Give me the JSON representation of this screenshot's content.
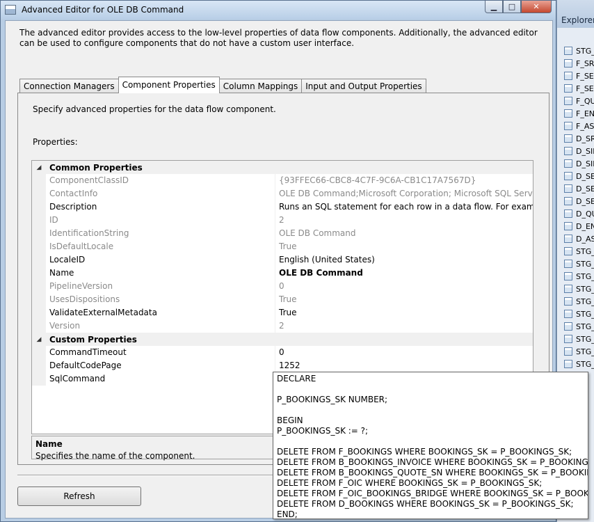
{
  "window": {
    "title": "Advanced Editor for OLE DB Command"
  },
  "intro_text": "The advanced editor provides access to the low-level properties of data flow components. Additionally, the advanced editor can be used to configure components that do not have a custom user interface.",
  "tabs": [
    {
      "label": "Connection Managers"
    },
    {
      "label": "Component Properties",
      "active": true
    },
    {
      "label": "Column Mappings"
    },
    {
      "label": "Input and Output Properties"
    }
  ],
  "panel": {
    "description": "Specify advanced properties for the data flow component.",
    "properties_label": "Properties:"
  },
  "grid": {
    "common_category": "Common Properties",
    "common": [
      {
        "name": "ComponentClassID",
        "value": "{93FFEC66-CBC8-4C7F-9C6A-CB1C17A7567D}",
        "disabled": true
      },
      {
        "name": "ContactInfo",
        "value": "OLE DB Command;Microsoft Corporation; Microsoft SQL Server; (C) Microsoft",
        "disabled": true
      },
      {
        "name": "Description",
        "value": "Runs an SQL statement for each row in a data flow. For example, call a stored procedure",
        "disabled": false
      },
      {
        "name": "ID",
        "value": "2",
        "disabled": true
      },
      {
        "name": "IdentificationString",
        "value": "OLE DB Command",
        "disabled": true
      },
      {
        "name": "IsDefaultLocale",
        "value": "True",
        "disabled": true
      },
      {
        "name": "LocaleID",
        "value": "English (United States)",
        "disabled": false
      },
      {
        "name": "Name",
        "value": "OLE DB Command",
        "disabled": false,
        "bold": true
      },
      {
        "name": "PipelineVersion",
        "value": "0",
        "disabled": true
      },
      {
        "name": "UsesDispositions",
        "value": "True",
        "disabled": true
      },
      {
        "name": "ValidateExternalMetadata",
        "value": "True",
        "disabled": false
      },
      {
        "name": "Version",
        "value": "2",
        "disabled": true
      }
    ],
    "custom_category": "Custom Properties",
    "custom": [
      {
        "name": "CommandTimeout",
        "value": "0",
        "disabled": false
      },
      {
        "name": "DefaultCodePage",
        "value": "1252",
        "disabled": false
      },
      {
        "name": "SqlCommand",
        "value": "",
        "disabled": false
      }
    ]
  },
  "help": {
    "title": "Name",
    "text": "Specifies the name of the component."
  },
  "sql_popup": "DECLARE\n\nP_BOOKINGS_SK NUMBER;\n\nBEGIN\nP_BOOKINGS_SK := ?;\n\nDELETE FROM F_BOOKINGS WHERE BOOKINGS_SK = P_BOOKINGS_SK;\nDELETE FROM B_BOOKINGS_INVOICE WHERE BOOKINGS_SK = P_BOOKINGS_SK;\nDELETE FROM B_BOOKINGS_QUOTE_SN WHERE BOOKINGS_SK = P_BOOKINGS_SK;\nDELETE FROM F_OIC WHERE BOOKINGS_SK = P_BOOKINGS_SK;\nDELETE FROM F_OIC_BOOKINGS_BRIDGE WHERE BOOKINGS_SK = P_BOOKINGS_SK;\nDELETE FROM D_BOOKINGS WHERE BOOKINGS_SK = P_BOOKINGS_SK;\nEND;",
  "buttons": {
    "refresh": "Refresh"
  },
  "explorer": {
    "title": "Explorer",
    "items": [
      "STG_",
      "F_SR",
      "F_SEF",
      "F_SEF",
      "F_QU",
      "F_EN",
      "F_AS",
      "D_SR",
      "D_SIE",
      "D_SIE",
      "D_SE",
      "D_SE",
      "D_SE",
      "D_QU",
      "D_EN",
      "D_AS",
      "STG_",
      "STG_",
      "STG_",
      "STG_",
      "STG_",
      "STG_",
      "STG_",
      "STG_",
      "STG_",
      "STG_"
    ]
  }
}
